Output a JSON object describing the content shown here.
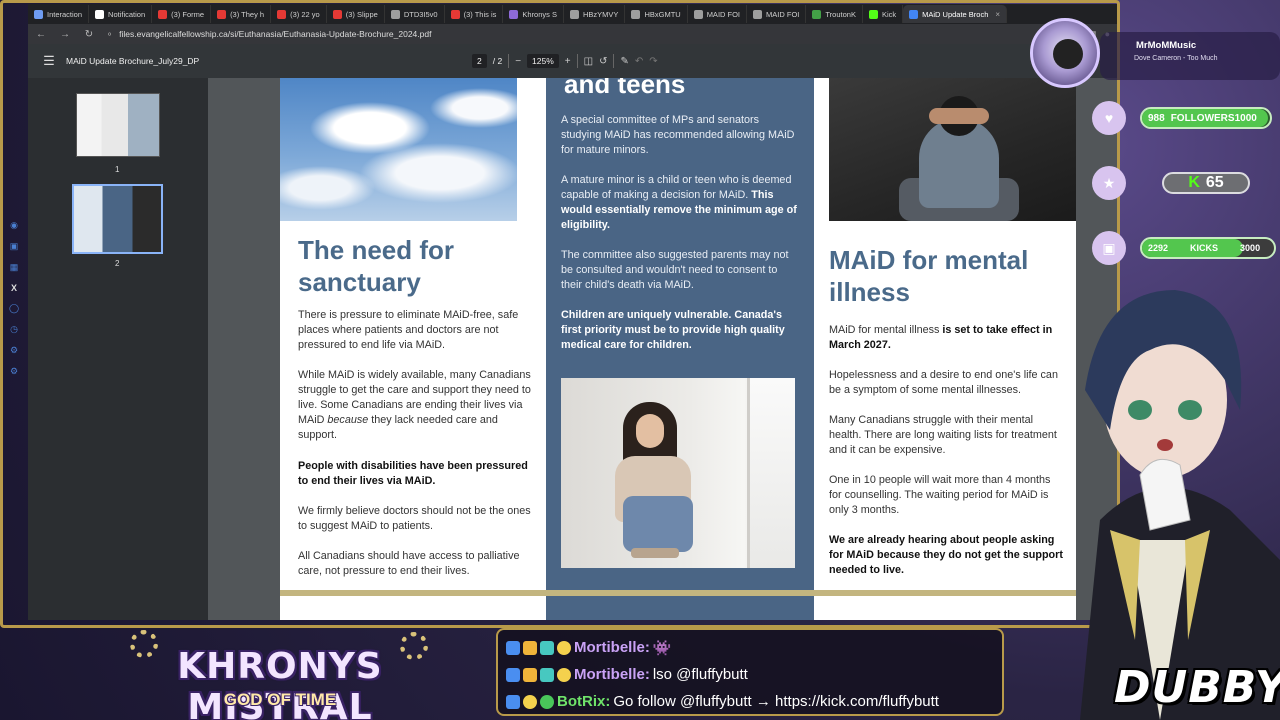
{
  "browser": {
    "tabs": [
      {
        "label": "Interaction",
        "color": "#6f9cf2"
      },
      {
        "label": "Notification",
        "color": "#ffffff"
      },
      {
        "label": "(3) Forme",
        "color": "#e53935"
      },
      {
        "label": "(3) They h",
        "color": "#e53935"
      },
      {
        "label": "(3) 22 yo",
        "color": "#e53935"
      },
      {
        "label": "(3) Slippe",
        "color": "#e53935"
      },
      {
        "label": "DTD3I5v0",
        "color": "#9e9e9e"
      },
      {
        "label": "(3) This is",
        "color": "#e53935"
      },
      {
        "label": "Khronys S",
        "color": "#8e6ad8"
      },
      {
        "label": "HBzYMVY",
        "color": "#9e9e9e"
      },
      {
        "label": "HBxGMTU",
        "color": "#9e9e9e"
      },
      {
        "label": "MAID FOI",
        "color": "#9e9e9e"
      },
      {
        "label": "MAID FOI",
        "color": "#9e9e9e"
      },
      {
        "label": "TroutonK",
        "color": "#43a047"
      },
      {
        "label": "Kick",
        "color": "#53fc18"
      },
      {
        "label": "MAiD Update Broch",
        "color": "#4285f4",
        "active": true
      }
    ],
    "url": "files.evangelicalfellowship.ca/si/Euthanasia/Euthanasia-Update-Brochure_2024.pdf"
  },
  "pdf": {
    "title": "MAiD Update Brochure_July29_DP",
    "page_current": "2",
    "page_total": "/  2",
    "zoom": "125%",
    "thumb_labels": [
      "1",
      "2"
    ]
  },
  "brochure": {
    "col1": {
      "heading": "The need for sanctuary",
      "p1": "There is pressure to eliminate MAiD-free, safe places where patients and doctors are not pressured to end life via MAiD.",
      "p2_start": "While MAiD is widely available, many Canadians struggle to get the care and support they need to live. Some Canadians are ending their lives via MAiD ",
      "p2_italic": "because",
      "p2_end": " they lack needed care and support.",
      "p3_bold": "People with disabilities have been pressured to end their lives via MAiD.",
      "p4": "We firmly believe doctors should not be the ones to suggest MAiD to patients.",
      "p5": "All Canadians should have access to palliative care, not pressure to end their lives."
    },
    "col2": {
      "heading_tail": "and teens",
      "p1": "A special committee of MPs and senators studying MAiD has recommended allowing MAiD for mature minors.",
      "p2_start": "A mature minor is a child or teen who is deemed capable of making a decision for MAiD. ",
      "p2_bold": "This would essentially remove the minimum age of eligibility.",
      "p3": "The committee also suggested parents may not be consulted and wouldn't need to consent to their child's death via MAiD.",
      "p4_bold": "Children are uniquely vulnerable. Canada's first priority must be to provide high quality medical care for children."
    },
    "col3": {
      "heading": "MAiD for mental illness",
      "p1_start": "MAiD for mental illness ",
      "p1_bold": "is set to take effect in March 2027.",
      "p2": "Hopelessness and a desire to end one's life can be a symptom of some mental illnesses.",
      "p3": "Many Canadians struggle with their mental health. There are long waiting lists for treatment and it can be expensive.",
      "p4": "One in 10 people will wait more than 4 months for counselling. The waiting period for MAiD is only 3 months.",
      "p5_bold": "We are already hearing about people asking for MAiD because they do not get the support needed to live."
    }
  },
  "overlay": {
    "music_user": "MrMoMMusic",
    "music_song": "Dove Cameron - Too Much",
    "followers_count": "988",
    "followers_label": "FOLLOWERS",
    "followers_goal": "1000",
    "followers_progress": 0.988,
    "kick_count": "65",
    "kicks_count": "2292",
    "kicks_label": "KICKS",
    "kicks_goal": "3000",
    "kicks_progress": 0.764,
    "logo_title": "KHRONYS MISTRAL",
    "logo_sub": "GOD OF TIME",
    "dubby": "DUBBY"
  },
  "chat": [
    {
      "user": "Mortibelle:",
      "user_color": "#c9a2f5",
      "msg": "👾"
    },
    {
      "user": "Mortibelle:",
      "user_color": "#c9a2f5",
      "msg": " lso @fluffybutt"
    },
    {
      "user": "BotRix:",
      "user_color": "#6fe36a",
      "msg": " Go follow @fluffybutt → https://kick.com/fluffybutt"
    }
  ]
}
